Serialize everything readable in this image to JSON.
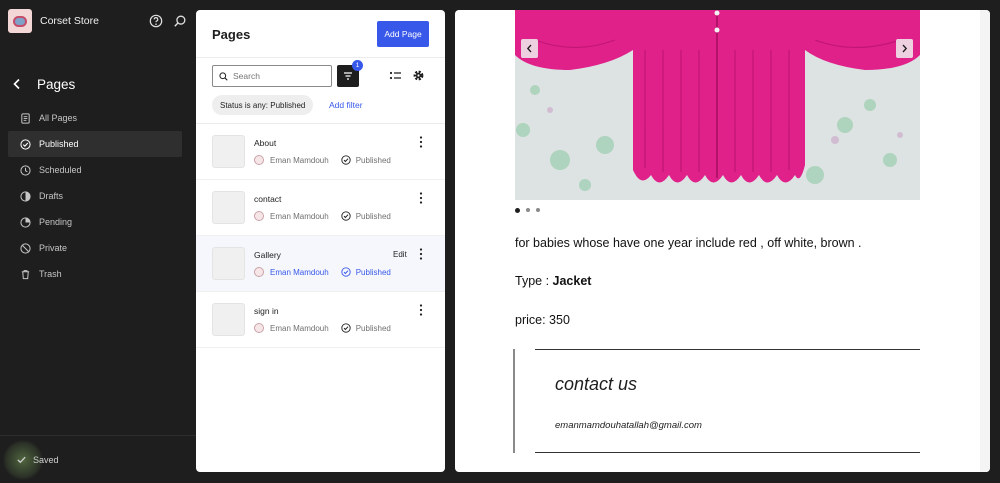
{
  "site": {
    "title": "Corset Store"
  },
  "nav": {
    "title": "Pages",
    "items": [
      {
        "label": "All Pages",
        "icon": "page-icon",
        "active": false
      },
      {
        "label": "Published",
        "icon": "published-icon",
        "active": true
      },
      {
        "label": "Scheduled",
        "icon": "clock-icon",
        "active": false
      },
      {
        "label": "Drafts",
        "icon": "drafts-icon",
        "active": false
      },
      {
        "label": "Pending",
        "icon": "pending-icon",
        "active": false
      },
      {
        "label": "Private",
        "icon": "private-icon",
        "active": false
      },
      {
        "label": "Trash",
        "icon": "trash-icon",
        "active": false
      }
    ]
  },
  "footer": {
    "saved_label": "Saved"
  },
  "panel": {
    "title": "Pages",
    "add_button": "Add Page",
    "search_placeholder": "Search",
    "filter_count": "1",
    "filter_chip": "Status is any: Published",
    "add_filter": "Add filter",
    "rows": [
      {
        "title": "About",
        "author": "Eman Mamdouh",
        "status": "Published"
      },
      {
        "title": "contact",
        "author": "Eman Mamdouh",
        "status": "Published"
      },
      {
        "title": "Gallery",
        "author": "Eman Mamdouh",
        "status": "Published",
        "edit_label": "Edit"
      },
      {
        "title": "sign in",
        "author": "Eman Mamdouh",
        "status": "Published"
      }
    ]
  },
  "preview": {
    "description": "for babies whose have one year include red , off white, brown .",
    "type_label": "Type : ",
    "type_value": "Jacket",
    "price": "price: 350",
    "contact_title": "contact us",
    "contact_email": "emanmamdouhatallah@gmail.com",
    "gallery_slides": 3,
    "gallery_current_slide": 1
  },
  "colors": {
    "accent": "#3858e9",
    "sidebar_bg": "#1e1e1e",
    "product_pink": "#e0218a"
  }
}
